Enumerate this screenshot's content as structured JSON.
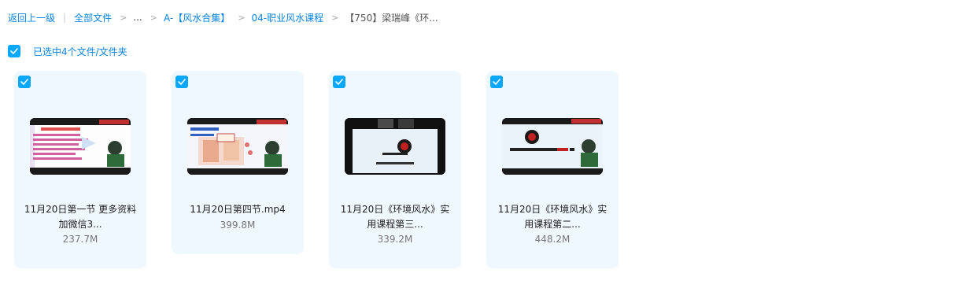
{
  "breadcrumb": {
    "back": "返回上一级",
    "all_files": "全部文件",
    "ellipsis": "...",
    "folder1": "A-【风水合集】",
    "folder2": "04-职业风水课程",
    "current": "【750】梁瑞峰《环...",
    "separator": ">",
    "pipe": "|"
  },
  "selection": {
    "label": "已选中4个文件/文件夹",
    "checked": true
  },
  "files": [
    {
      "name_line1": "11月20日第一节 更多资料",
      "name_line2": "加微信3...",
      "size": "237.7M",
      "checked": true
    },
    {
      "name_line1": "11月20日第四节.mp4",
      "name_line2": "",
      "size": "399.8M",
      "checked": true
    },
    {
      "name_line1": "11月20日《环境风水》实",
      "name_line2": "用课程第三...",
      "size": "339.2M",
      "checked": true
    },
    {
      "name_line1": "11月20日《环境风水》实",
      "name_line2": "用课程第二...",
      "size": "448.2M",
      "checked": true
    }
  ],
  "colors": {
    "accent": "#06a7ff",
    "link": "#0a84e0",
    "card_bg": "#f0f8ff"
  }
}
